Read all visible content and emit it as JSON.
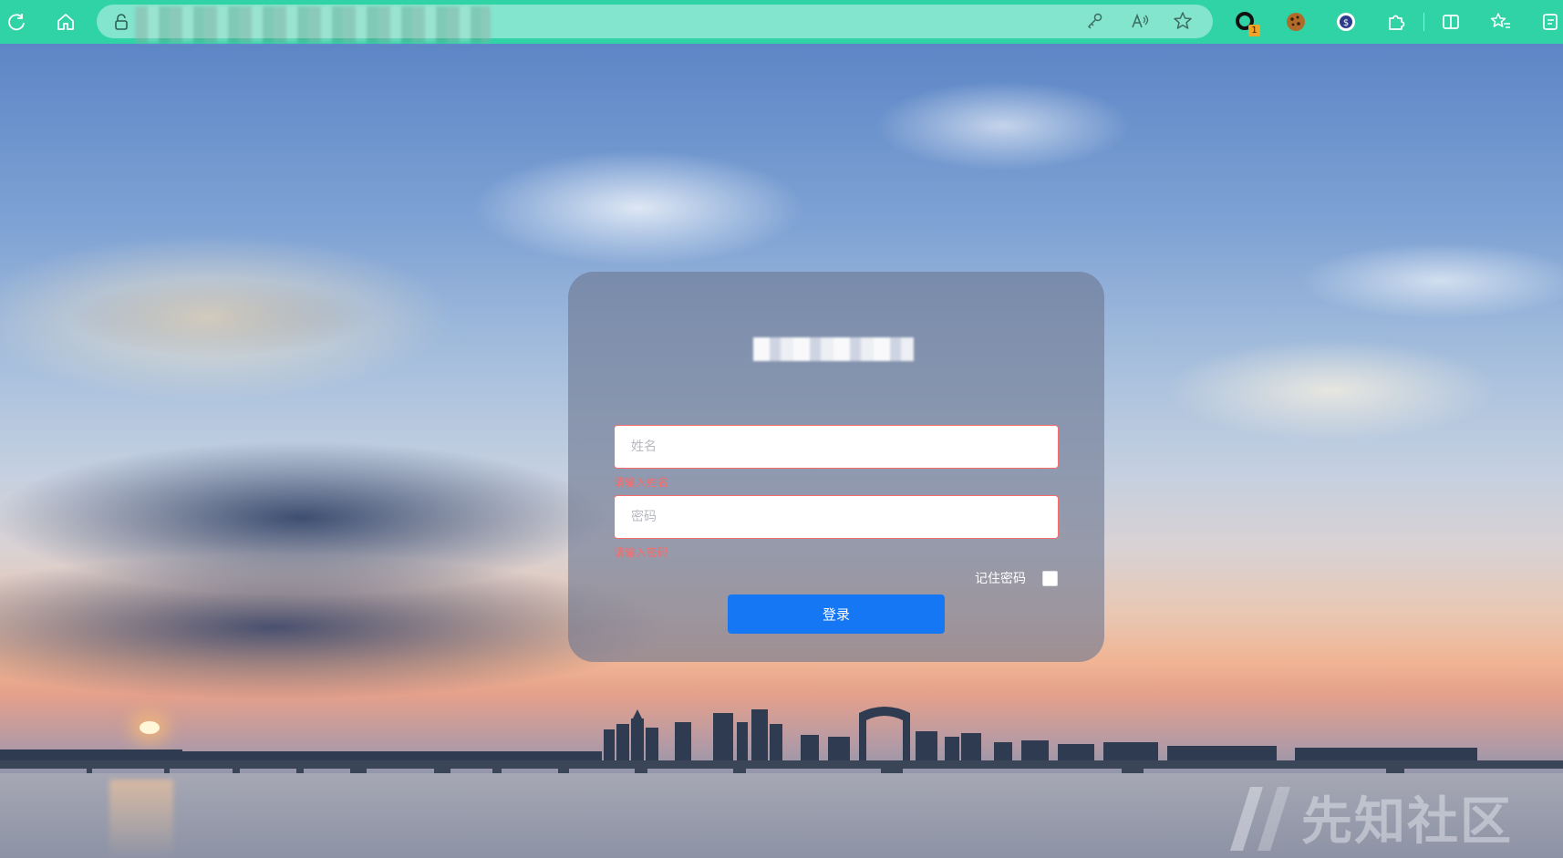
{
  "browser": {
    "url": "",
    "extension_badge": "1",
    "icons": {
      "reload": "reload-icon",
      "home": "home-icon",
      "lock": "lock-icon",
      "key": "key-icon",
      "read_aloud": "read-aloud-icon",
      "favorite": "star-icon",
      "extension1": "extension-icon",
      "cookie": "cookie-icon",
      "extension3": "extension-icon",
      "extensions": "puzzle-icon",
      "split_screen": "split-screen-icon",
      "favorites": "favorites-icon",
      "collections": "collections-icon"
    },
    "colors": {
      "toolbar": "#2fd3a6",
      "address_bar": "#83e5cd"
    }
  },
  "login": {
    "title": "",
    "name_placeholder": "姓名",
    "name_value": "",
    "name_error": "请输入姓名",
    "password_placeholder": "密码",
    "password_value": "",
    "password_error": "请输入密码",
    "remember_label": "记住密码",
    "remember_checked": false,
    "submit_label": "登录",
    "colors": {
      "button": "#1677f5",
      "error": "#f56c6c"
    }
  },
  "watermark": {
    "text": "先知社区"
  }
}
